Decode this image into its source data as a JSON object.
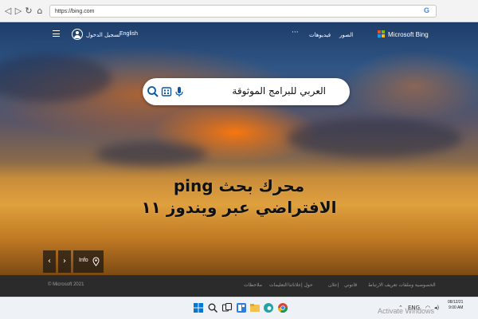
{
  "browser": {
    "url": "https://bing.com",
    "back_icon": "back-arrow-icon",
    "forward_icon": "forward-arrow-icon",
    "reload_icon": "reload-icon",
    "home_icon": "home-icon",
    "google_badge": "G"
  },
  "header": {
    "logo_text": "Microsoft Bing",
    "nav": {
      "images": "الصور",
      "videos": "فيديوهات",
      "more": "···"
    },
    "language": "English",
    "sign_in": "تسجيل الدخول"
  },
  "search": {
    "query": "العربي للبرامج الموثوقة",
    "icons": [
      "search-icon",
      "visual-search-icon",
      "microphone-icon"
    ]
  },
  "headline": {
    "line1": "محرك بحث ping",
    "line2": "الافتراضي عبر ويندوز ١١"
  },
  "image_nav": {
    "prev": "‹",
    "next": "›",
    "info_label": "Info"
  },
  "footer": {
    "copyright": "© Microsoft 2021",
    "links": [
      "الخصوصية وملفات تعريف الارتباط",
      "قانوني",
      "إعلان",
      "حول إعلاناتنا",
      "التعليمات",
      "ملاحظات"
    ]
  },
  "taskbar": {
    "watermark": "Activate Windows",
    "lang": "ENG",
    "time": "9:00 AM",
    "date": "08/12/21",
    "colors": {
      "start": "#0078d4",
      "edge": "#1fa3a3",
      "explorer": "#f2c14e",
      "chrome": "#db4437"
    }
  },
  "theme": {
    "accent": "#0078d4",
    "ms_red": "#f25022",
    "ms_green": "#7fba00",
    "ms_blue": "#00a4ef",
    "ms_yellow": "#ffb900"
  }
}
